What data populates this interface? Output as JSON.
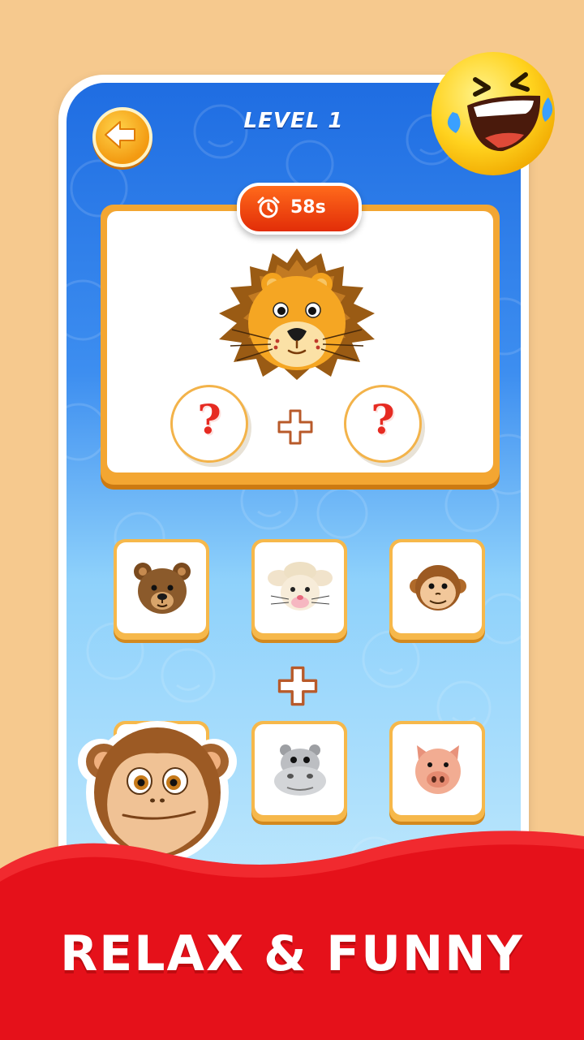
{
  "header": {
    "level_label": "LEVEL 1",
    "back_icon": "arrow-left-icon"
  },
  "timer": {
    "icon": "alarm-clock-icon",
    "value": "58s"
  },
  "question": {
    "target_emoji": "lion-face",
    "slots": [
      {
        "symbol": "?"
      },
      {
        "symbol": "?"
      }
    ],
    "operator": "plus"
  },
  "choices": [
    {
      "emoji": "bear-face"
    },
    {
      "emoji": "rabbit-face"
    },
    {
      "emoji": "monkey-face"
    },
    {
      "emoji": "monkey-face-large"
    },
    {
      "emoji": "hippo-face"
    },
    {
      "emoji": "pig-face"
    }
  ],
  "tagline": "RELAX & FUNNY",
  "colors": {
    "background": "#f6c98e",
    "screen_top": "#1f6de2",
    "screen_bottom": "#bfe8fd",
    "card_border": "#f3a632",
    "timer": "#e22d08",
    "question_mark": "#e62b22",
    "banner_red": "#e5111a"
  }
}
